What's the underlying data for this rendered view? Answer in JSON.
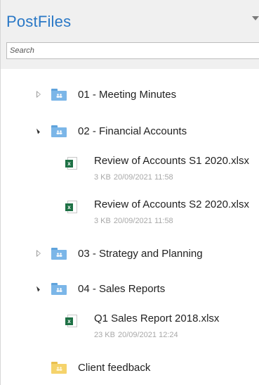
{
  "app": {
    "title": "PostFiles"
  },
  "search": {
    "placeholder": "Search"
  },
  "colors": {
    "accent": "#2a78c6",
    "shared_folder": "#7bb6e8",
    "local_folder": "#f5d36b",
    "excel_green": "#1e7145"
  },
  "tree": {
    "folder1": {
      "name": "01 - Meeting Minutes",
      "state": "collapsed",
      "icon": "shared-folder-icon"
    },
    "folder2": {
      "name": "02 - Financial Accounts",
      "state": "expanded",
      "icon": "shared-folder-icon",
      "files": [
        {
          "name": "Review of Accounts  S1 2020.xlsx",
          "size": "3 KB",
          "date": "20/09/2021 11:58",
          "icon": "excel-icon"
        },
        {
          "name": "Review of Accounts S2 2020.xlsx",
          "size": "3 KB",
          "date": "20/09/2021 11:58",
          "icon": "excel-icon"
        }
      ]
    },
    "folder3": {
      "name": "03 - Strategy and Planning",
      "state": "collapsed",
      "icon": "shared-folder-icon"
    },
    "folder4": {
      "name": "04 - Sales Reports",
      "state": "expanded",
      "icon": "shared-folder-icon",
      "files": [
        {
          "name": "Q1 Sales Report 2018.xlsx",
          "size": "23 KB",
          "date": "20/09/2021 12:24",
          "icon": "excel-icon"
        }
      ]
    },
    "folder5": {
      "name": "Client feedback",
      "icon": "folder-icon"
    }
  }
}
